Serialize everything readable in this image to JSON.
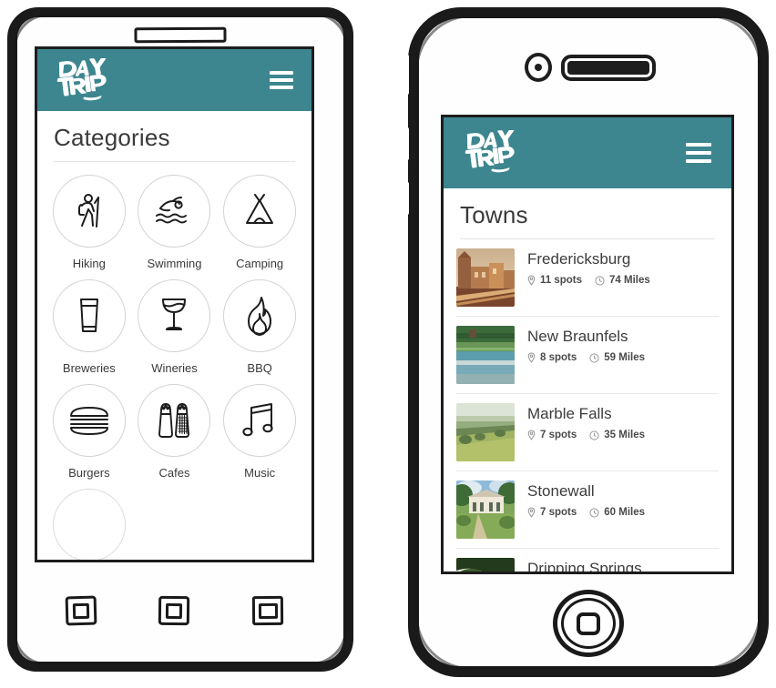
{
  "app": {
    "brand_line1": "DAY",
    "brand_line2": "TRIP",
    "accent_color": "#3d868f",
    "menu_icon": "hamburger-icon"
  },
  "android_screen": {
    "title": "Categories",
    "categories": [
      {
        "label": "Hiking",
        "icon": "hiker-icon"
      },
      {
        "label": "Swimming",
        "icon": "swimmer-icon"
      },
      {
        "label": "Camping",
        "icon": "tent-icon"
      },
      {
        "label": "Breweries",
        "icon": "beer-glass-icon"
      },
      {
        "label": "Wineries",
        "icon": "wine-glass-icon"
      },
      {
        "label": "BBQ",
        "icon": "flame-icon"
      },
      {
        "label": "Burgers",
        "icon": "burger-icon"
      },
      {
        "label": "Cafes",
        "icon": "salt-pepper-icon"
      },
      {
        "label": "Music",
        "icon": "music-note-icon"
      }
    ]
  },
  "ios_screen": {
    "title": "Towns",
    "spots_icon": "map-pin-icon",
    "distance_icon": "clock-icon",
    "towns": [
      {
        "name": "Fredericksburg",
        "spots": "11 spots",
        "distance": "74 Miles",
        "thumb": "town-street-photo"
      },
      {
        "name": "New Braunfels",
        "spots": "8 spots",
        "distance": "59 Miles",
        "thumb": "river-photo"
      },
      {
        "name": "Marble Falls",
        "spots": "7 spots",
        "distance": "35 Miles",
        "thumb": "hillside-photo"
      },
      {
        "name": "Stonewall",
        "spots": "7 spots",
        "distance": "60 Miles",
        "thumb": "ranch-house-photo"
      },
      {
        "name": "Dripping Springs",
        "spots": "",
        "distance": "",
        "thumb": "grotto-photo"
      }
    ]
  },
  "hardware": {
    "android": {
      "speaker": "earpiece-speaker",
      "nav_buttons": [
        "recent-apps-button",
        "home-button",
        "back-button"
      ]
    },
    "ios": {
      "camera": "front-camera",
      "speaker": "earpiece-speaker",
      "side_buttons": [
        "silent-switch",
        "volume-up-button",
        "volume-down-button"
      ],
      "home": "home-button"
    }
  }
}
